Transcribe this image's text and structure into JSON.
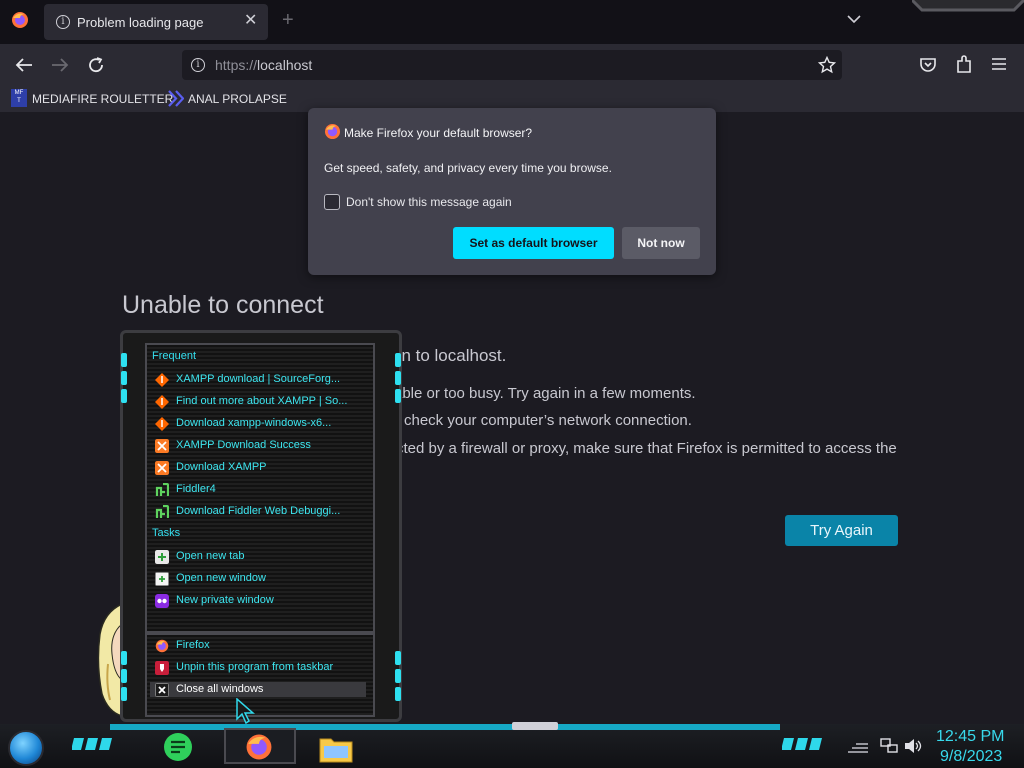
{
  "browser": {
    "tab_title": "Problem loading page",
    "url_scheme": "https://",
    "url_host": "localhost",
    "bookmarks": [
      {
        "label": "MEDIAFIRE ROULETTER",
        "icon": "mft-icon"
      },
      {
        "label": "ANAL PROLAPSE",
        "icon": "bookmark-chevron-icon"
      }
    ]
  },
  "error_page": {
    "title": "Unable to connect",
    "subtitle": "on to localhost.",
    "lines": [
      "able or too busy. Try again in a few moments.",
      "check your computer’s network connection.",
      "cted by a firewall or proxy, make sure that Firefox is permitted to access the"
    ],
    "try_again": "Try Again"
  },
  "popup": {
    "title": "Make Firefox your default browser?",
    "body": "Get speed, safety, and privacy every time you browse.",
    "checkbox_label": "Don't show this message again",
    "primary": "Set as default browser",
    "secondary": "Not now"
  },
  "jumplist": {
    "frequent_heading": "Frequent",
    "frequent": [
      {
        "label": "XAMPP download | SourceForg...",
        "icon": "sourceforge-icon"
      },
      {
        "label": "Find out more about XAMPP | So...",
        "icon": "sourceforge-icon"
      },
      {
        "label": "Download xampp-windows-x6...",
        "icon": "sourceforge-icon"
      },
      {
        "label": "XAMPP Download Success",
        "icon": "xampp-icon"
      },
      {
        "label": "Download XAMPP",
        "icon": "xampp-icon"
      },
      {
        "label": "Fiddler4",
        "icon": "fiddler-icon"
      },
      {
        "label": "Download Fiddler Web Debuggi...",
        "icon": "fiddler-icon"
      }
    ],
    "tasks_heading": "Tasks",
    "tasks": [
      {
        "label": "Open new tab",
        "icon": "new-tab-icon"
      },
      {
        "label": "Open new window",
        "icon": "new-window-icon"
      },
      {
        "label": "New private window",
        "icon": "private-window-icon"
      }
    ],
    "app": [
      {
        "label": "Firefox",
        "icon": "firefox-icon"
      },
      {
        "label": "Unpin this program from taskbar",
        "icon": "unpin-icon"
      },
      {
        "label": "Close all windows",
        "icon": "close-icon"
      }
    ]
  },
  "taskbar": {
    "time": "12:45 PM",
    "date": "9/8/2023"
  },
  "colors": {
    "accent_cyan": "#00ddff",
    "jumplist_text": "#3de6f0",
    "try_button": "#0a84a8"
  }
}
